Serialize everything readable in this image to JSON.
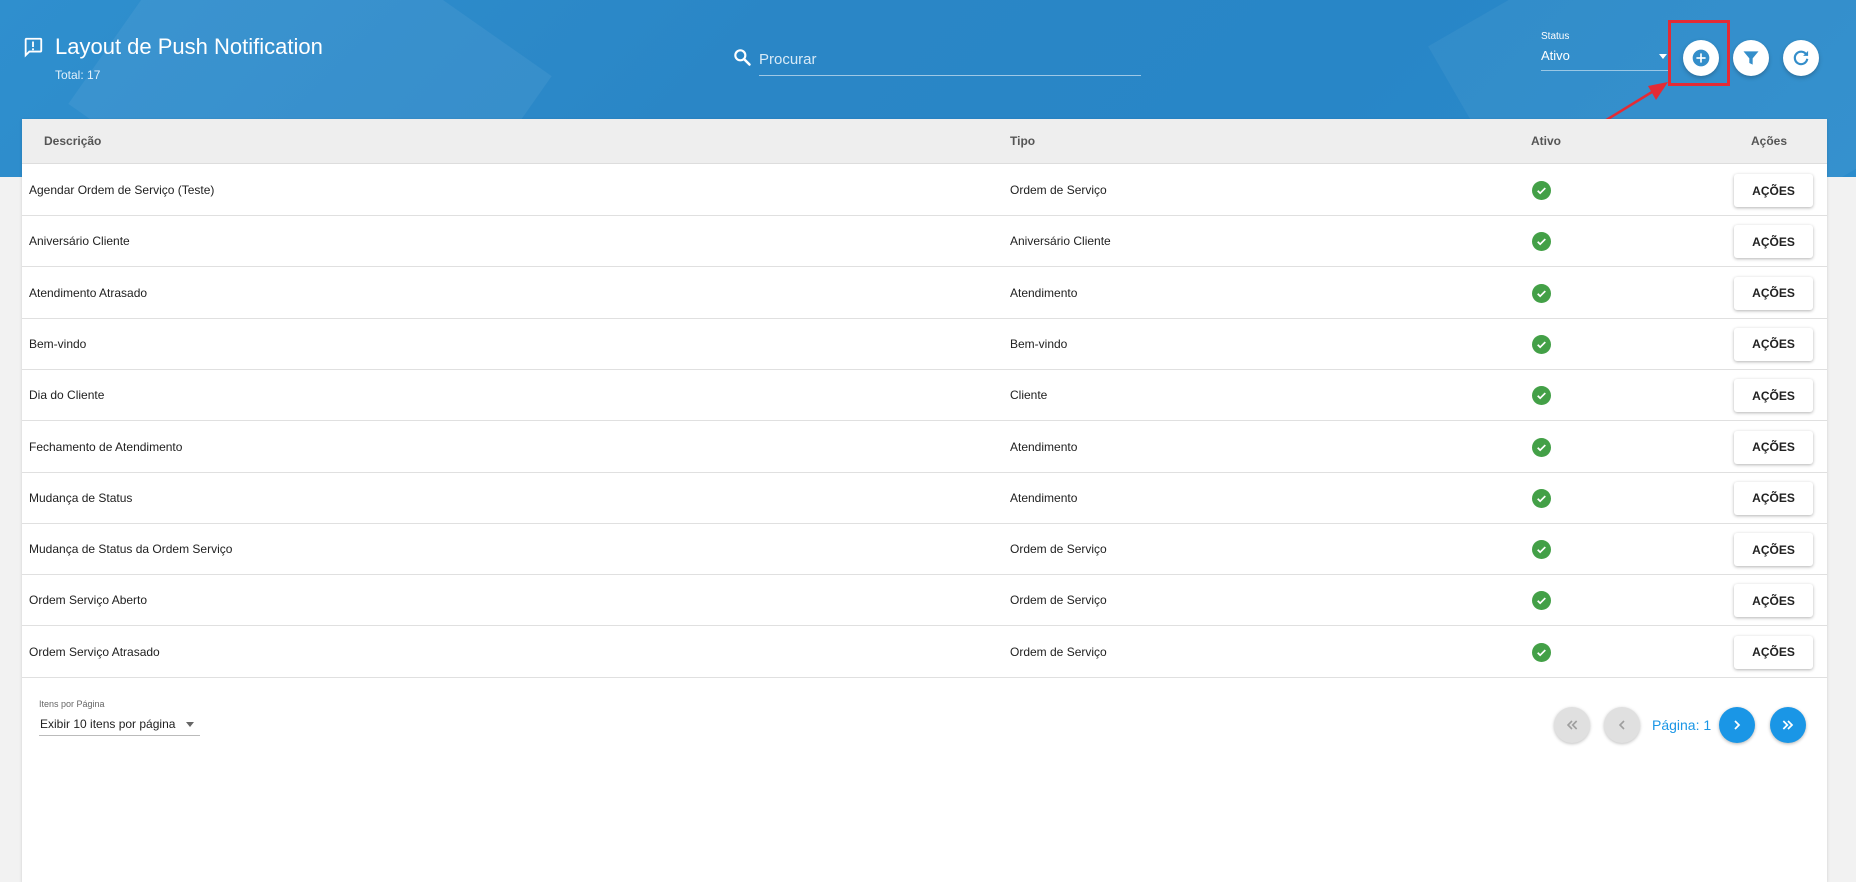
{
  "header": {
    "title": "Layout de Push Notification",
    "total": "Total: 17",
    "search_placeholder": "Procurar",
    "status_label": "Status",
    "status_value": "Ativo",
    "icons": {
      "title": "notification-alert-icon",
      "search": "search-icon",
      "add": "add-circle-icon",
      "filter": "filter-icon",
      "refresh": "refresh-icon"
    }
  },
  "table": {
    "columns": [
      "Descrição",
      "Tipo",
      "Ativo",
      "Ações"
    ],
    "rows": [
      {
        "descricao": "Agendar Ordem de Serviço (Teste)",
        "tipo": "Ordem de Serviço",
        "action": "AÇÕES"
      },
      {
        "descricao": "Aniversário Cliente",
        "tipo": "Aniversário Cliente",
        "action": "AÇÕES"
      },
      {
        "descricao": "Atendimento Atrasado",
        "tipo": "Atendimento",
        "action": "AÇÕES"
      },
      {
        "descricao": "Bem-vindo",
        "tipo": "Bem-vindo",
        "action": "AÇÕES"
      },
      {
        "descricao": "Dia do Cliente",
        "tipo": "Cliente",
        "action": "AÇÕES"
      },
      {
        "descricao": "Fechamento de Atendimento",
        "tipo": "Atendimento",
        "action": "AÇÕES"
      },
      {
        "descricao": "Mudança de Status",
        "tipo": "Atendimento",
        "action": "AÇÕES"
      },
      {
        "descricao": "Mudança de Status da Ordem Serviço",
        "tipo": "Ordem de Serviço",
        "action": "AÇÕES"
      },
      {
        "descricao": "Ordem Serviço Aberto",
        "tipo": "Ordem de Serviço",
        "action": "AÇÕES"
      },
      {
        "descricao": "Ordem Serviço Atrasado",
        "tipo": "Ordem de Serviço",
        "action": "AÇÕES"
      }
    ]
  },
  "pagination": {
    "items_label": "Itens por Página",
    "items_value": "Exibir 10 itens por página",
    "page_label": "Página: 1"
  },
  "colors": {
    "header": "#2a88c8",
    "active_check": "#43a047",
    "pagination_active": "#1a96e6",
    "highlight": "#e3202b"
  }
}
